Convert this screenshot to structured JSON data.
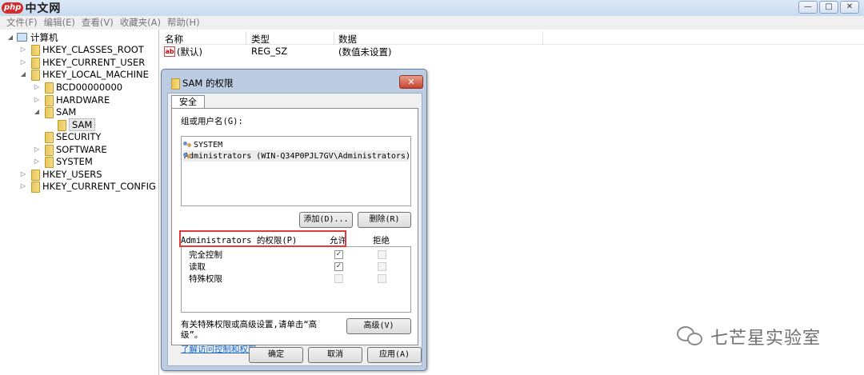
{
  "window": {
    "logo_badge": "php",
    "logo_text": "中文网",
    "minimize": "—",
    "maximize": "□",
    "close": "✕"
  },
  "menu": [
    "文件(F)",
    "编辑(E)",
    "查看(V)",
    "收藏夹(A)",
    "帮助(H)"
  ],
  "tree": {
    "root": "计算机",
    "items": [
      {
        "label": "HKEY_CLASSES_ROOT",
        "expander": "▷"
      },
      {
        "label": "HKEY_CURRENT_USER",
        "expander": "▷"
      },
      {
        "label": "HKEY_LOCAL_MACHINE",
        "expander": "◢"
      },
      {
        "label": "BCD00000000",
        "expander": "▷"
      },
      {
        "label": "HARDWARE",
        "expander": "▷"
      },
      {
        "label": "SAM",
        "expander": "◢"
      },
      {
        "label": "SAM",
        "expander": ""
      },
      {
        "label": "SECURITY",
        "expander": ""
      },
      {
        "label": "SOFTWARE",
        "expander": "▷"
      },
      {
        "label": "SYSTEM",
        "expander": "▷"
      },
      {
        "label": "HKEY_USERS",
        "expander": "▷"
      },
      {
        "label": "HKEY_CURRENT_CONFIG",
        "expander": "▷"
      }
    ]
  },
  "list": {
    "headers": [
      "名称",
      "类型",
      "数据"
    ],
    "rows": [
      {
        "icon": "ab",
        "name": "(默认)",
        "type": "REG_SZ",
        "data": "(数值未设置)"
      }
    ]
  },
  "dialog": {
    "title": "SAM 的权限",
    "close": "✕",
    "tab": "安全",
    "group_label": "组或用户名(G):",
    "groups": [
      "SYSTEM",
      "Administrators (WIN-Q34P0PJL7GV\\Administrators)"
    ],
    "add_button": "添加(D)...",
    "remove_button": "删除(R)",
    "perm_label": "Administrators 的权限(P)",
    "allow_header": "允许",
    "deny_header": "拒绝",
    "permissions": [
      {
        "name": "完全控制",
        "allow": "✓",
        "deny": ""
      },
      {
        "name": "读取",
        "allow": "✓",
        "deny": ""
      },
      {
        "name": "特殊权限",
        "allow": "",
        "deny": ""
      }
    ],
    "advanced_text_line1": "有关特殊权限或高级设置,请单击“高",
    "advanced_text_line2": "级”。",
    "advanced_button": "高级(V)",
    "link": "了解访问控制和权限",
    "ok": "确定",
    "cancel": "取消",
    "apply": "应用(A)"
  },
  "watermark": "七芒星实验室"
}
